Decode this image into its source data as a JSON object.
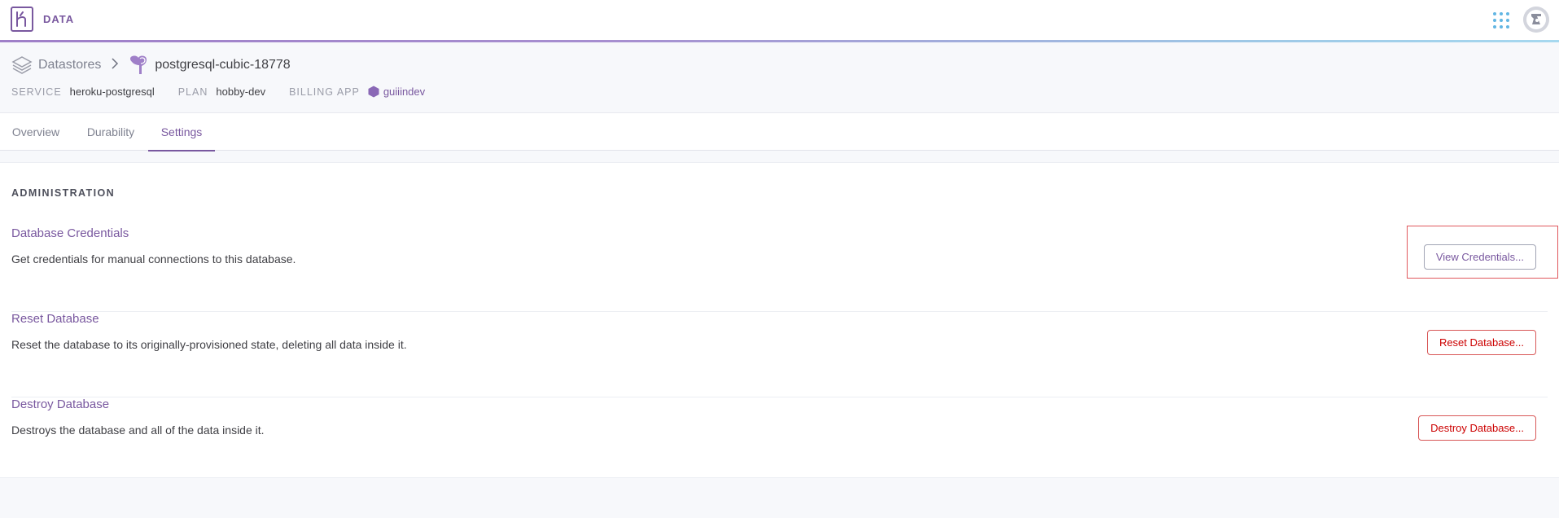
{
  "app": {
    "name": "DATA"
  },
  "breadcrumb": {
    "parent": "Datastores",
    "current": "postgresql-cubic-18778"
  },
  "meta": {
    "service_label": "SERVICE",
    "service_value": "heroku-postgresql",
    "plan_label": "PLAN",
    "plan_value": "hobby-dev",
    "billing_label": "BILLING APP",
    "billing_value": "guiiindev"
  },
  "tabs": [
    {
      "label": "Overview",
      "active": false
    },
    {
      "label": "Durability",
      "active": false
    },
    {
      "label": "Settings",
      "active": true
    }
  ],
  "administration": {
    "title": "ADMINISTRATION",
    "rows": [
      {
        "title": "Database Credentials",
        "description": "Get credentials for manual connections to this database.",
        "button": "View Credentials..."
      },
      {
        "title": "Reset Database",
        "description": "Reset the database to its originally-provisioned state, deleting all data inside it.",
        "button": "Reset Database..."
      },
      {
        "title": "Destroy Database",
        "description": "Destroys the database and all of the data inside it.",
        "button": "Destroy Database..."
      }
    ]
  },
  "colors": {
    "brand": "#79589f",
    "danger": "#cc0000",
    "apps_icon": "#62b6e3",
    "highlight": "#e0585d"
  },
  "icons": {
    "logo": "heroku-logo-icon",
    "apps": "app-grid-icon",
    "avatar": "user-avatar-icon",
    "datastores": "datastores-stack-icon",
    "chevron": "chevron-right-icon",
    "postgres": "postgres-elephant-icon",
    "app": "hexagon-app-icon"
  }
}
